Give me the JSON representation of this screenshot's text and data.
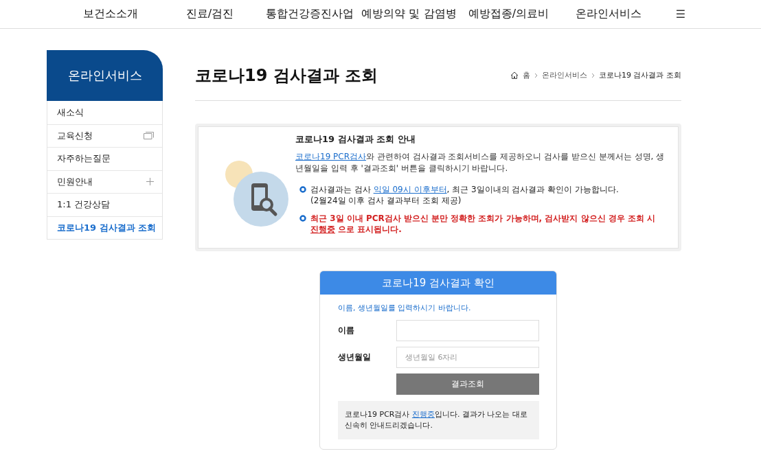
{
  "nav": {
    "items": [
      {
        "label": "보건소소개"
      },
      {
        "label": "진료/검진"
      },
      {
        "label": "통합건강증진사업"
      },
      {
        "label": "예방의약 및 감염병"
      },
      {
        "label": "예방접종/의료비"
      },
      {
        "label": "온라인서비스"
      }
    ],
    "menu_icon": "☰"
  },
  "sidebar": {
    "title": "온라인서비스",
    "items": [
      {
        "label": "새소식",
        "kind": "plain",
        "selected": false
      },
      {
        "label": "교육신청",
        "kind": "window",
        "selected": false
      },
      {
        "label": "자주하는질문",
        "kind": "plain",
        "selected": false
      },
      {
        "label": "민원안내",
        "kind": "expand",
        "selected": false
      },
      {
        "label": "1:1 건강상담",
        "kind": "plain",
        "selected": false
      },
      {
        "label": "코로나19 검사결과 조회",
        "kind": "plain",
        "selected": true
      }
    ]
  },
  "page": {
    "title": "코로나19 검사결과 조회",
    "breadcrumb": [
      "홈",
      "온라인서비스",
      "코로나19 검사결과 조회"
    ]
  },
  "notice": {
    "title": "코로나19 검사결과 조회 안내",
    "intro": [
      {
        "kind": "link",
        "text": "코로나19 PCR검사"
      },
      {
        "kind": "text",
        "text": "와 관련하여 검사결과 조회서비스를 제공하오니 검사를 받으신 분께서는 성명, 생년월일을 입력 후 '결과조회' 버튼을 클릭하시기 바랍니다."
      }
    ],
    "notes": [
      {
        "kind": "info",
        "parts": [
          {
            "kind": "text",
            "text": "검사결과는 검사 "
          },
          {
            "kind": "link",
            "text": "익일 09시 이후부터"
          },
          {
            "kind": "text",
            "text": ", 최근 3일이내의 검사결과 확인이 가능합니다."
          }
        ],
        "subline": "(2월24일 이후 검사 결과부터 조회 제공)"
      },
      {
        "kind": "warning",
        "parts": [
          {
            "kind": "text",
            "text": "최근 3일 이내 PCR검사 받으신 분만 정확한 조회가 가능하며, 검사받지 않으신 경우 조회 시 "
          },
          {
            "kind": "link",
            "text": "진행중"
          },
          {
            "kind": "text",
            "text": " 으로 표시됩니다."
          }
        ]
      }
    ]
  },
  "form": {
    "title": "코로나19 검사결과 확인",
    "hint": "이름, 생년월일를 입력하시기 바랍니다.",
    "fields": [
      {
        "label": "이름"
      },
      {
        "label": "생년월일",
        "placeholder": "생년월일 6자리"
      }
    ],
    "button": "결과조회",
    "status": [
      {
        "kind": "text",
        "text": "코로나19 PCR검사 "
      },
      {
        "kind": "link",
        "text": "진행중"
      },
      {
        "kind": "text",
        "text": "입니다. 결과가 나오는 대로 신속히 안내드리겠습니다."
      }
    ]
  }
}
